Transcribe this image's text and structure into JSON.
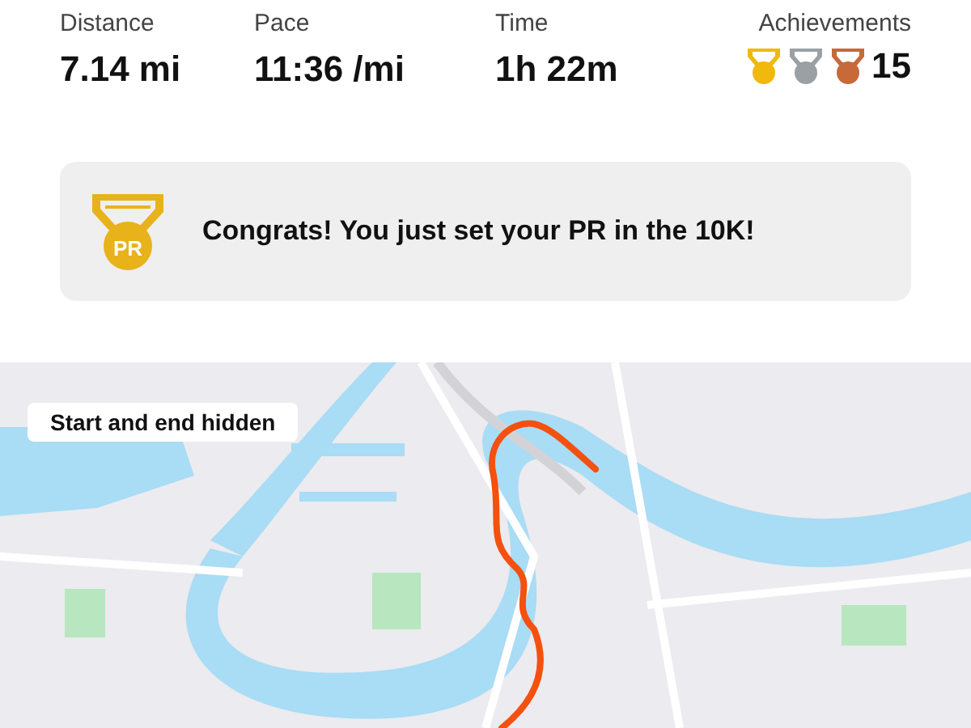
{
  "stats": [
    {
      "label": "Distance",
      "value": "7.14 mi"
    },
    {
      "label": "Pace",
      "value": "11:36 /mi"
    },
    {
      "label": "Time",
      "value": "1h 22m"
    }
  ],
  "achievements": {
    "label": "Achievements",
    "medals": [
      {
        "color": "#f0b90b"
      },
      {
        "color": "#9aa0a3"
      },
      {
        "color": "#c8693a"
      }
    ],
    "count": "15"
  },
  "banner": {
    "badge": "PR",
    "message": "Congrats! You just set your PR in the 10K!"
  },
  "map": {
    "notice": "Start and end hidden"
  }
}
